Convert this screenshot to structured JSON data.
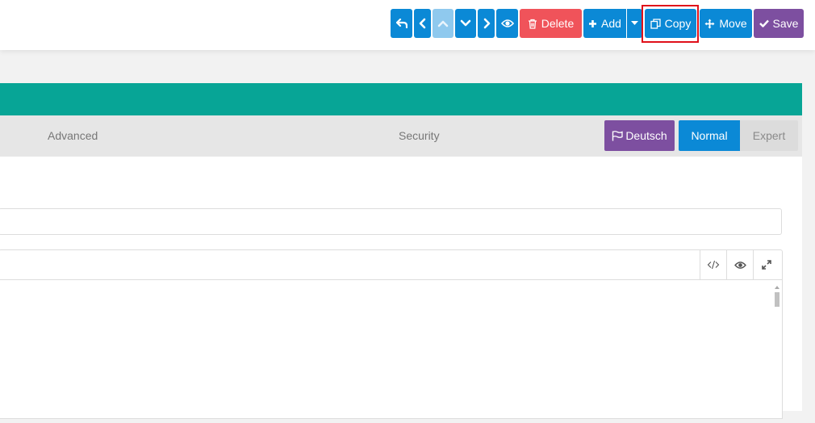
{
  "toolbar": {
    "undo_icon": "undo-arrow-icon",
    "prev_icon": "chevron-left-icon",
    "up_icon": "chevron-up-icon",
    "down_icon": "chevron-down-icon",
    "next_icon": "chevron-right-icon",
    "preview_icon": "eye-icon",
    "delete_label": "Delete",
    "add_label": "Add",
    "copy_label": "Copy",
    "move_label": "Move",
    "save_label": "Save"
  },
  "tabs": {
    "advanced": "Advanced",
    "security": "Security",
    "language_label": "Deutsch",
    "mode_normal": "Normal",
    "mode_expert": "Expert"
  },
  "editor": {
    "code_icon": "code-icon",
    "preview_icon": "eye-icon",
    "fullscreen_icon": "expand-icon"
  },
  "colors": {
    "primary": "#0b89d6",
    "danger": "#f0535a",
    "purple": "#7d4fa0",
    "teal": "#07a596",
    "highlight": "#e0101a"
  }
}
